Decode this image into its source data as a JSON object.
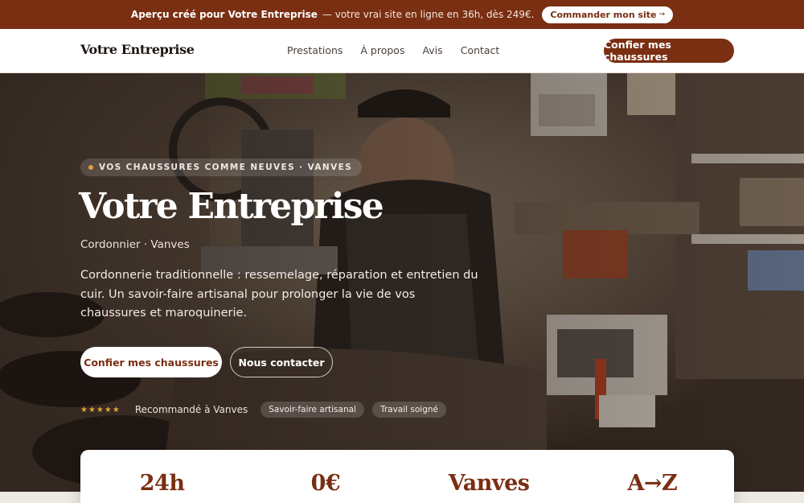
{
  "promo": {
    "lead": "Aperçu créé pour Votre Entreprise",
    "rest": "— votre vrai site en ligne en 36h, dès 249€.",
    "button": "Commander mon site",
    "button_arrow": "→"
  },
  "nav": {
    "brand": "Votre Entreprise",
    "links": [
      "Prestations",
      "À propos",
      "Avis",
      "Contact"
    ],
    "cta": "Confier mes chaussures"
  },
  "hero": {
    "eyebrow": "VOS CHAUSSURES COMME NEUVES · VANVES",
    "title": "Votre Entreprise",
    "subtitle": "Cordonnier · Vanves",
    "description": "Cordonnerie traditionnelle : ressemelage, réparation et entretien du cuir. Un savoir-faire artisanal pour prolonger la vie de vos chaussures et maroquinerie.",
    "primary_button": "Confier mes chaussures",
    "secondary_button": "Nous contacter",
    "stars": "★★★★★",
    "recommendation": "Recommandé à Vanves",
    "chips": [
      "Savoir-faire artisanal",
      "Travail soigné"
    ]
  },
  "stats": [
    "24h",
    "0€",
    "Vanves",
    "A→Z"
  ],
  "colors": {
    "brand": "#7a2e12",
    "star": "#e0a43a"
  }
}
